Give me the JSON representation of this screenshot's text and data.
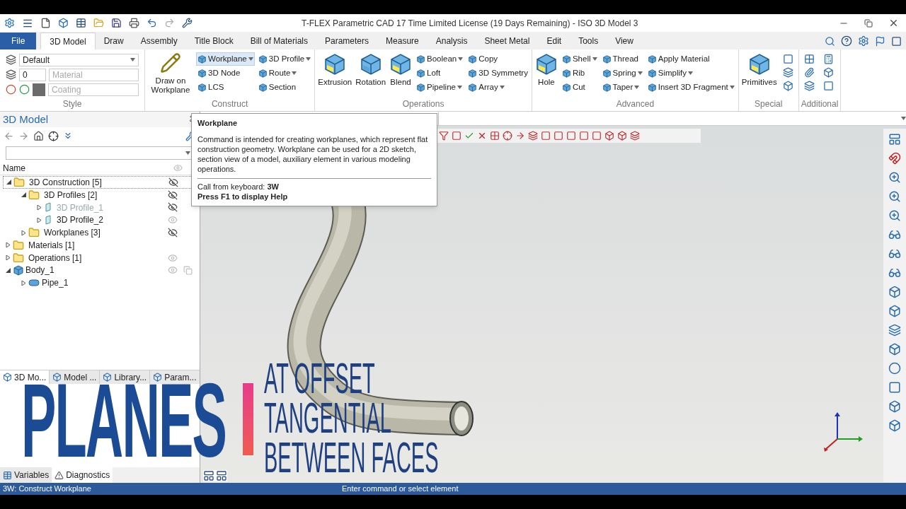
{
  "window": {
    "title": "T-FLEX Parametric CAD 17 Time Limited License (19 Days Remaining) - ISO 3D Model 3"
  },
  "menu_tabs": [
    {
      "label": "File",
      "kind": "file",
      "selected": false
    },
    {
      "label": "3D Model",
      "kind": "tab",
      "selected": true
    },
    {
      "label": "Draw",
      "kind": "tab",
      "selected": false
    },
    {
      "label": "Assembly",
      "kind": "tab",
      "selected": false
    },
    {
      "label": "Title Block",
      "kind": "tab",
      "selected": false
    },
    {
      "label": "Bill of Materials",
      "kind": "tab",
      "selected": false
    },
    {
      "label": "Parameters",
      "kind": "tab",
      "selected": false
    },
    {
      "label": "Measure",
      "kind": "tab",
      "selected": false
    },
    {
      "label": "Analysis",
      "kind": "tab",
      "selected": false
    },
    {
      "label": "Sheet Metal",
      "kind": "tab",
      "selected": false
    },
    {
      "label": "Edit",
      "kind": "tab",
      "selected": false
    },
    {
      "label": "Tools",
      "kind": "tab",
      "selected": false
    },
    {
      "label": "View",
      "kind": "tab",
      "selected": false
    }
  ],
  "style_group": {
    "label": "Style",
    "style_value": "Default",
    "layer_value": "0",
    "material_placeholder": "Material",
    "coating_placeholder": "Coating"
  },
  "ribbon_groups": [
    {
      "label": "Construct",
      "kind": "construct",
      "large": [
        {
          "label": "Draw on Workplane"
        }
      ],
      "columns": [
        [
          {
            "label": "Workplane",
            "dropdown": true,
            "hovered": true
          },
          {
            "label": "3D Node",
            "dropdown": false,
            "hovered": false
          },
          {
            "label": "LCS",
            "dropdown": false,
            "hovered": false
          }
        ],
        [
          {
            "label": "3D Profile",
            "dropdown": true,
            "hovered": false
          },
          {
            "label": "Route",
            "dropdown": true,
            "hovered": false
          },
          {
            "label": "Section",
            "dropdown": false,
            "hovered": false
          }
        ]
      ]
    },
    {
      "label": "Operations",
      "kind": "operations",
      "large": [
        {
          "label": "Extrusion"
        },
        {
          "label": "Rotation"
        },
        {
          "label": "Blend"
        }
      ],
      "columns": [
        [
          {
            "label": "Boolean",
            "dropdown": true,
            "hovered": false
          },
          {
            "label": "Loft",
            "dropdown": false,
            "hovered": false
          },
          {
            "label": "Pipeline",
            "dropdown": true,
            "hovered": false
          }
        ],
        [
          {
            "label": "Copy",
            "dropdown": false,
            "hovered": false
          },
          {
            "label": "3D Symmetry",
            "dropdown": false,
            "hovered": false
          },
          {
            "label": "Array",
            "dropdown": true,
            "hovered": false
          }
        ]
      ]
    },
    {
      "label": "Advanced",
      "kind": "advanced",
      "large": [
        {
          "label": "Hole"
        }
      ],
      "columns": [
        [
          {
            "label": "Shell",
            "dropdown": true,
            "hovered": false
          },
          {
            "label": "Rib",
            "dropdown": false,
            "hovered": false
          },
          {
            "label": "Cut",
            "dropdown": false,
            "hovered": false
          }
        ],
        [
          {
            "label": "Thread",
            "dropdown": false,
            "hovered": false
          },
          {
            "label": "Spring",
            "dropdown": true,
            "hovered": false
          },
          {
            "label": "Taper",
            "dropdown": true,
            "hovered": false
          }
        ],
        [
          {
            "label": "Apply Material",
            "dropdown": false,
            "hovered": false
          },
          {
            "label": "Simplify",
            "dropdown": true,
            "hovered": false
          },
          {
            "label": "Insert 3D Fragment",
            "dropdown": true,
            "hovered": false
          }
        ]
      ]
    },
    {
      "label": "Special",
      "kind": "special",
      "large": [
        {
          "label": "Primitives"
        }
      ]
    },
    {
      "label": "Additional",
      "kind": "additional"
    }
  ],
  "tree_panel": {
    "title": "3D Model",
    "name_column": "Name",
    "tree": [
      {
        "label": "3D Construction [5]",
        "kind": "folder",
        "expanded": true,
        "dimmed": false,
        "visible": false,
        "children": [
          {
            "label": "3D Profiles [2]",
            "kind": "folder",
            "expanded": true,
            "dimmed": false,
            "visible": false,
            "children": [
              {
                "label": "3D Profile_1",
                "kind": "profile",
                "expanded": false,
                "dimmed": true,
                "visible": false
              },
              {
                "label": "3D Profile_2",
                "kind": "profile",
                "expanded": false,
                "dimmed": false,
                "visible": true
              }
            ]
          },
          {
            "label": "Workplanes [3]",
            "kind": "folder",
            "expanded": false,
            "dimmed": false,
            "visible": false
          }
        ]
      },
      {
        "label": "Materials [1]",
        "kind": "folder",
        "expanded": false,
        "dimmed": false
      },
      {
        "label": "Operations [1]",
        "kind": "folder",
        "expanded": false,
        "dimmed": false,
        "visible": true
      },
      {
        "label": "Body_1",
        "kind": "body",
        "expanded": true,
        "dimmed": false,
        "visible": true,
        "children": [
          {
            "label": "Pipe_1",
            "kind": "pipe",
            "expanded": false,
            "dimmed": false
          }
        ]
      }
    ]
  },
  "panel_tabs": [
    {
      "label": "3D Mo...",
      "selected": true
    },
    {
      "label": "Model ...",
      "selected": false
    },
    {
      "label": "Library...",
      "selected": false
    },
    {
      "label": "Param...",
      "selected": false
    }
  ],
  "bottom_tabs": [
    {
      "label": "Variables",
      "selected": false
    },
    {
      "label": "Diagnostics",
      "selected": true
    }
  ],
  "tooltip": {
    "title": "Workplane",
    "body": "Command is intended for creating workplanes, which represent flat construction geometry. Workplane can be used for a 2D sketch, section view of a model, auxiliary element in various modeling operations.",
    "shortcut": "Call from keyboard: **3W**",
    "help": "Press F1 to display Help"
  },
  "overlay": {
    "title": "PLANES",
    "lines": [
      "AT OFFSET",
      "TANGENTIAL",
      "BETWEEN FACES"
    ]
  },
  "status_bar": {
    "left": "3W: Construct Workplane",
    "center": "Enter command or select element"
  }
}
